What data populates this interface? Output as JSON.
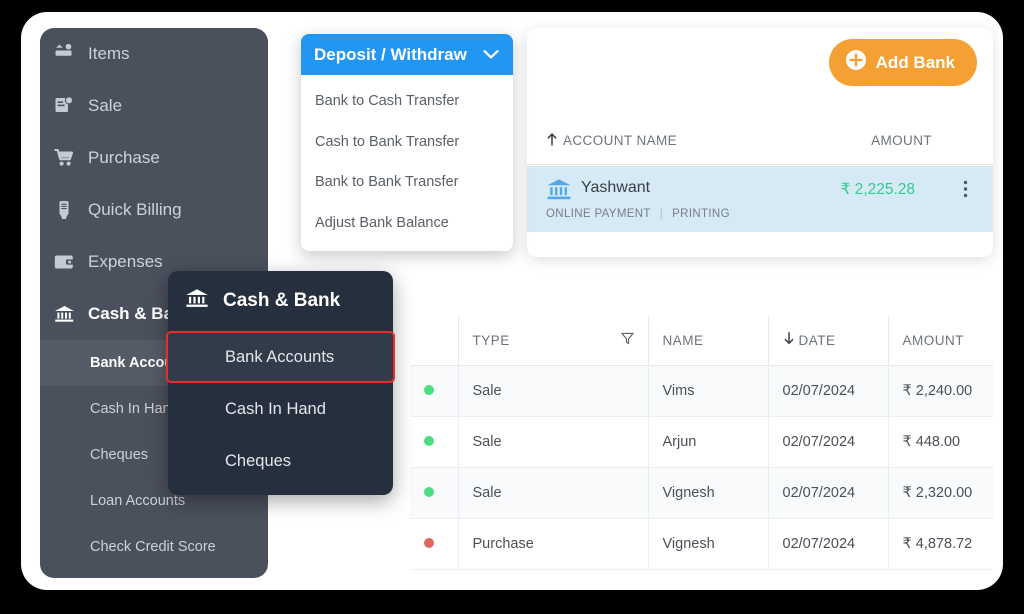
{
  "sidebar": {
    "items": [
      {
        "label": "Items",
        "icon": "items-icon"
      },
      {
        "label": "Sale",
        "icon": "sale-icon"
      },
      {
        "label": "Purchase",
        "icon": "cart-icon"
      },
      {
        "label": "Quick Billing",
        "icon": "billing-icon"
      },
      {
        "label": "Expenses",
        "icon": "wallet-icon"
      },
      {
        "label": "Cash & Bank",
        "icon": "bank-icon"
      }
    ],
    "sub_items": [
      {
        "label": "Bank Accounts",
        "selected": true
      },
      {
        "label": "Cash In Hand",
        "selected": false
      },
      {
        "label": "Cheques",
        "selected": false
      },
      {
        "label": "Loan Accounts",
        "selected": false
      },
      {
        "label": "Check Credit Score",
        "selected": false
      }
    ]
  },
  "deposit_dropdown": {
    "title": "Deposit / Withdraw",
    "chevron": "chevron-down-icon",
    "items": [
      "Bank to Cash Transfer",
      "Cash to Bank Transfer",
      "Bank to Bank Transfer",
      "Adjust Bank Balance"
    ]
  },
  "accounts_panel": {
    "add_bank_label": "Add Bank",
    "add_bank_icon": "plus-circle-icon",
    "header": {
      "account_name": "ACCOUNT NAME",
      "amount": "AMOUNT",
      "sort_icon": "sort-asc-icon"
    },
    "row": {
      "icon": "bank-icon",
      "name": "Yashwant",
      "amount": "₹ 2,225.28",
      "tags": [
        "ONLINE PAYMENT",
        "PRINTING"
      ],
      "menu_icon": "more-vertical-icon"
    }
  },
  "context_menu": {
    "title": "Cash & Bank",
    "title_icon": "bank-icon",
    "items": [
      {
        "label": "Bank Accounts",
        "highlighted": true
      },
      {
        "label": "Cash In Hand",
        "highlighted": false
      },
      {
        "label": "Cheques",
        "highlighted": false
      }
    ]
  },
  "transactions": {
    "columns": [
      "",
      "TYPE",
      "NAME",
      "DATE",
      "AMOUNT"
    ],
    "type_filter_icon": "filter-icon",
    "date_sort_icon": "sort-desc-icon",
    "rows": [
      {
        "status": "green",
        "type": "Sale",
        "name": "Vims",
        "date": "02/07/2024",
        "amount": "₹ 2,240.00",
        "sign": "pos"
      },
      {
        "status": "green",
        "type": "Sale",
        "name": "Arjun",
        "date": "02/07/2024",
        "amount": "₹ 448.00",
        "sign": "pos"
      },
      {
        "status": "green",
        "type": "Sale",
        "name": "Vignesh",
        "date": "02/07/2024",
        "amount": "₹ 2,320.00",
        "sign": "pos"
      },
      {
        "status": "red",
        "type": "Purchase",
        "name": "Vignesh",
        "date": "02/07/2024",
        "amount": "₹ 4,878.72",
        "sign": "neg"
      }
    ]
  },
  "colors": {
    "accent_blue": "#2196f3",
    "accent_orange": "#f5a033",
    "positive_green": "#3ab5a0",
    "negative_red": "#e8615c",
    "sidebar_bg": "#4a505c",
    "context_menu_bg": "#262f3d",
    "highlight_border": "#ee2b2b",
    "account_row_bg": "#d5eaf5"
  }
}
